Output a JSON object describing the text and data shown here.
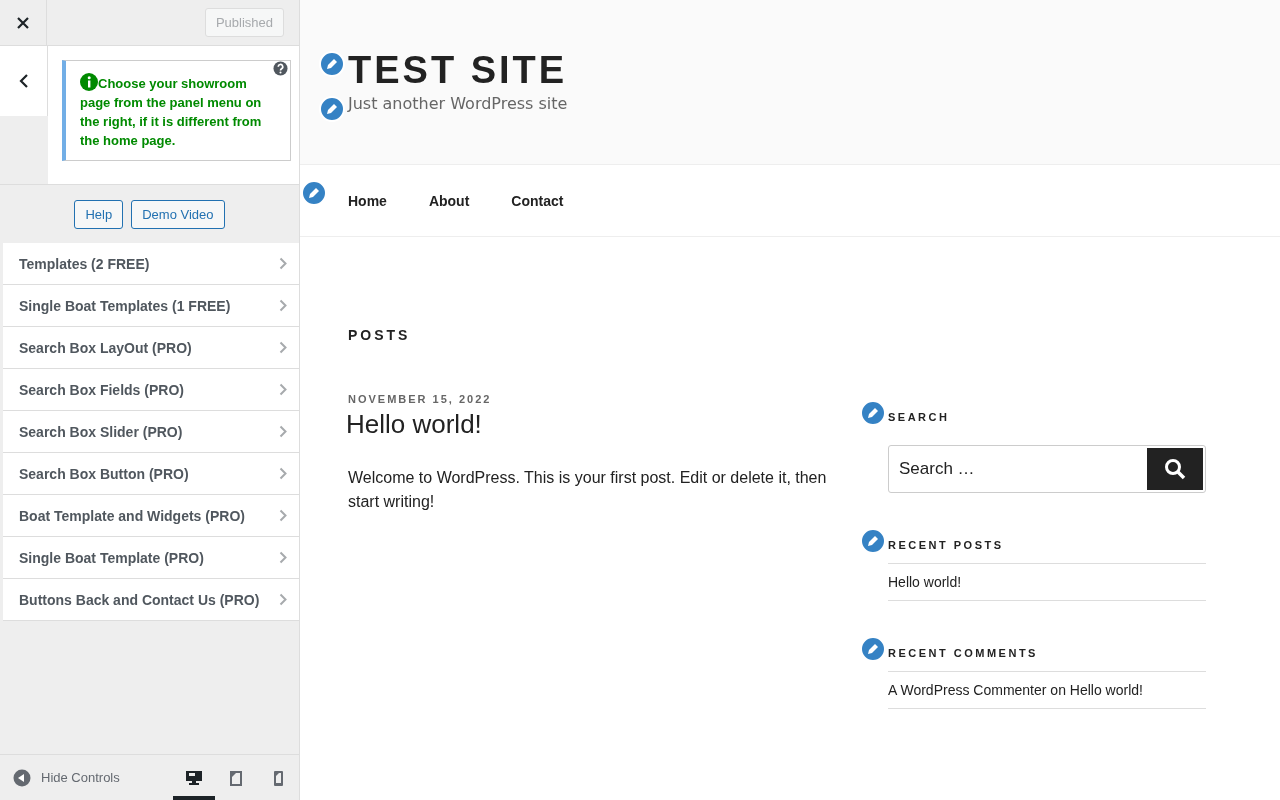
{
  "customizer": {
    "publish_button": {
      "label": "Published",
      "disabled": true
    },
    "notice": "Choose your showroom page from the panel menu on the right, if it is different from the home page.",
    "buttons": [
      "Help",
      "Demo Video"
    ],
    "sections": [
      "Templates (2 FREE)",
      "Single Boat Templates (1 FREE)",
      "Search Box LayOut (PRO)",
      "Search Box Fields (PRO)",
      "Search Box Slider (PRO)",
      "Search Box Button (PRO)",
      "Boat Template and Widgets (PRO)",
      "Single Boat Template (PRO)",
      "Buttons Back and Contact Us (PRO)"
    ],
    "footer": {
      "hide_controls": "Hide Controls",
      "devices": [
        {
          "kind": "desktop",
          "selected": true
        },
        {
          "kind": "tablet",
          "selected": false
        },
        {
          "kind": "mobile",
          "selected": false
        }
      ]
    }
  },
  "preview": {
    "site_title": "TEST SITE",
    "tagline": "Just another WordPress site",
    "nav": [
      "Home",
      "About",
      "Contact"
    ],
    "posts_heading": "POSTS",
    "post": {
      "date": "NOVEMBER 15, 2022",
      "title": "Hello world!",
      "excerpt": "Welcome to WordPress. This is your first post. Edit or delete it, then start writing!"
    },
    "widgets": {
      "search_heading": "SEARCH",
      "search_placeholder": "Search …",
      "recent_posts_heading": "RECENT POSTS",
      "recent_posts": [
        "Hello world!"
      ],
      "recent_comments_heading": "RECENT COMMENTS",
      "recent_comments": [
        {
          "author": "A WordPress Commenter",
          "on": "on",
          "post": "Hello world!"
        }
      ]
    }
  }
}
